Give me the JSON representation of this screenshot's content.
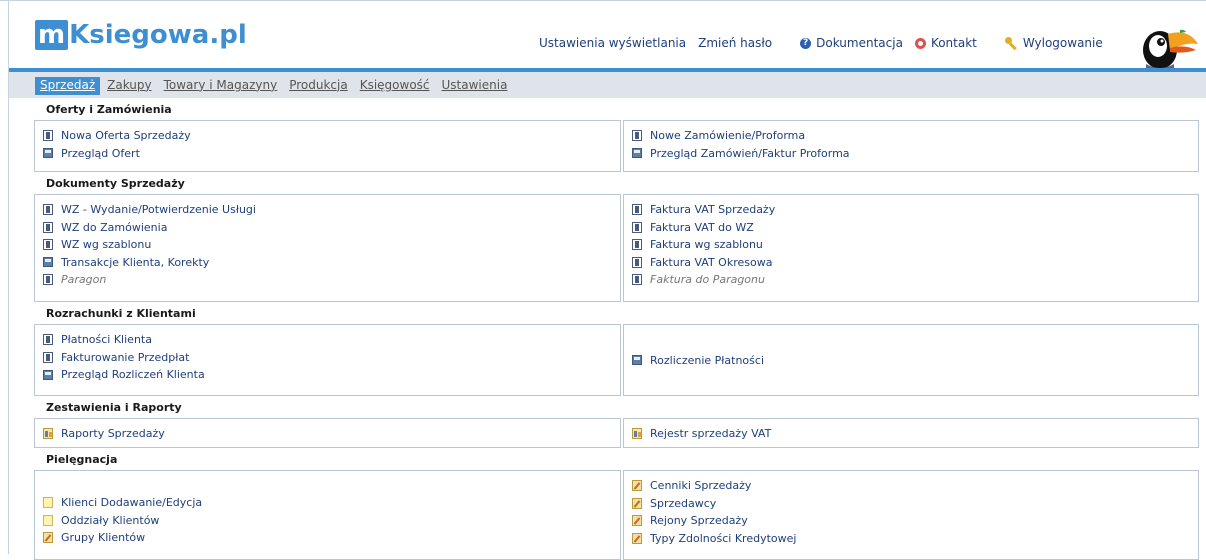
{
  "app": {
    "logo_m": "m",
    "logo_main": "Ksiegowa",
    "logo_dot": ".",
    "logo_pl": "pl"
  },
  "toplinks": {
    "display_settings": "Ustawienia wyświetlania",
    "change_password": "Zmień hasło",
    "documentation": "Dokumentacja",
    "contact": "Kontakt",
    "logout": "Wylogowanie"
  },
  "nav": {
    "items": [
      {
        "label": "Sprzedaż",
        "active": true
      },
      {
        "label": "Zakupy"
      },
      {
        "label": "Towary i Magazyny"
      },
      {
        "label": "Produkcja"
      },
      {
        "label": "Księgowość"
      },
      {
        "label": "Ustawienia"
      }
    ]
  },
  "sections": [
    {
      "title": "Oferty i Zamówienia",
      "left": [
        {
          "label": "Nowa Oferta Sprzedaży",
          "icon": "document-icon"
        },
        {
          "label": "Przegląd Ofert",
          "icon": "folder-icon"
        }
      ],
      "right": [
        {
          "label": "Nowe Zamówienie/Proforma",
          "icon": "document-icon"
        },
        {
          "label": "Przegląd Zamówień/Faktur Proforma",
          "icon": "folder-icon"
        }
      ]
    },
    {
      "title": "Dokumenty Sprzedaży",
      "left": [
        {
          "label": "WZ - Wydanie/Potwierdzenie Usługi",
          "icon": "document-icon"
        },
        {
          "label": "WZ do Zamówienia",
          "icon": "document-icon"
        },
        {
          "label": "WZ wg szablonu",
          "icon": "document-icon"
        },
        {
          "label": "Transakcje Klienta, Korekty",
          "icon": "folder-icon"
        },
        {
          "label": "Paragon",
          "icon": "document-icon"
        }
      ],
      "right": [
        {
          "label": "Faktura VAT Sprzedaży",
          "icon": "document-icon"
        },
        {
          "label": "Faktura VAT do WZ",
          "icon": "document-icon"
        },
        {
          "label": "Faktura wg szablonu",
          "icon": "document-icon"
        },
        {
          "label": "Faktura VAT Okresowa",
          "icon": "document-icon"
        },
        {
          "label": "Faktura do Paragonu",
          "icon": "document-icon"
        }
      ]
    },
    {
      "title": "Rozrachunki z Klientami",
      "left": [
        {
          "label": "Płatności Klienta",
          "icon": "document-icon"
        },
        {
          "label": "Fakturowanie Przedpłat",
          "icon": "document-icon"
        },
        {
          "label": "Przegląd Rozliczeń Klienta",
          "icon": "folder-icon"
        }
      ],
      "right": [
        {
          "label": "Rozliczenie Płatności",
          "icon": "folder-icon"
        }
      ]
    },
    {
      "title": "Zestawienia i Raporty",
      "left": [
        {
          "label": "Raporty Sprzedaży",
          "icon": "report-icon"
        }
      ],
      "right": [
        {
          "label": "Rejestr sprzedaży VAT",
          "icon": "report-icon"
        }
      ]
    },
    {
      "title": "Pielęgnacja",
      "left": [
        {
          "label": "Klienci Dodawanie/Edycja",
          "icon": "note-icon"
        },
        {
          "label": "Oddziały Klientów",
          "icon": "note-icon"
        },
        {
          "label": "Grupy Klientów",
          "icon": "edit-icon"
        }
      ],
      "right": [
        {
          "label": "Cenniki Sprzedaży",
          "icon": "edit-icon"
        },
        {
          "label": "Sprzedawcy",
          "icon": "edit-icon"
        },
        {
          "label": "Rejony Sprzedaży",
          "icon": "edit-icon"
        },
        {
          "label": "Typy Zdolności Kredytowej",
          "icon": "edit-icon"
        }
      ]
    }
  ],
  "colors": {
    "accent": "#3d8fd1",
    "link": "#1f3f7a",
    "nav_bg": "#dfe4ea",
    "box_border": "#b8c6d6"
  }
}
